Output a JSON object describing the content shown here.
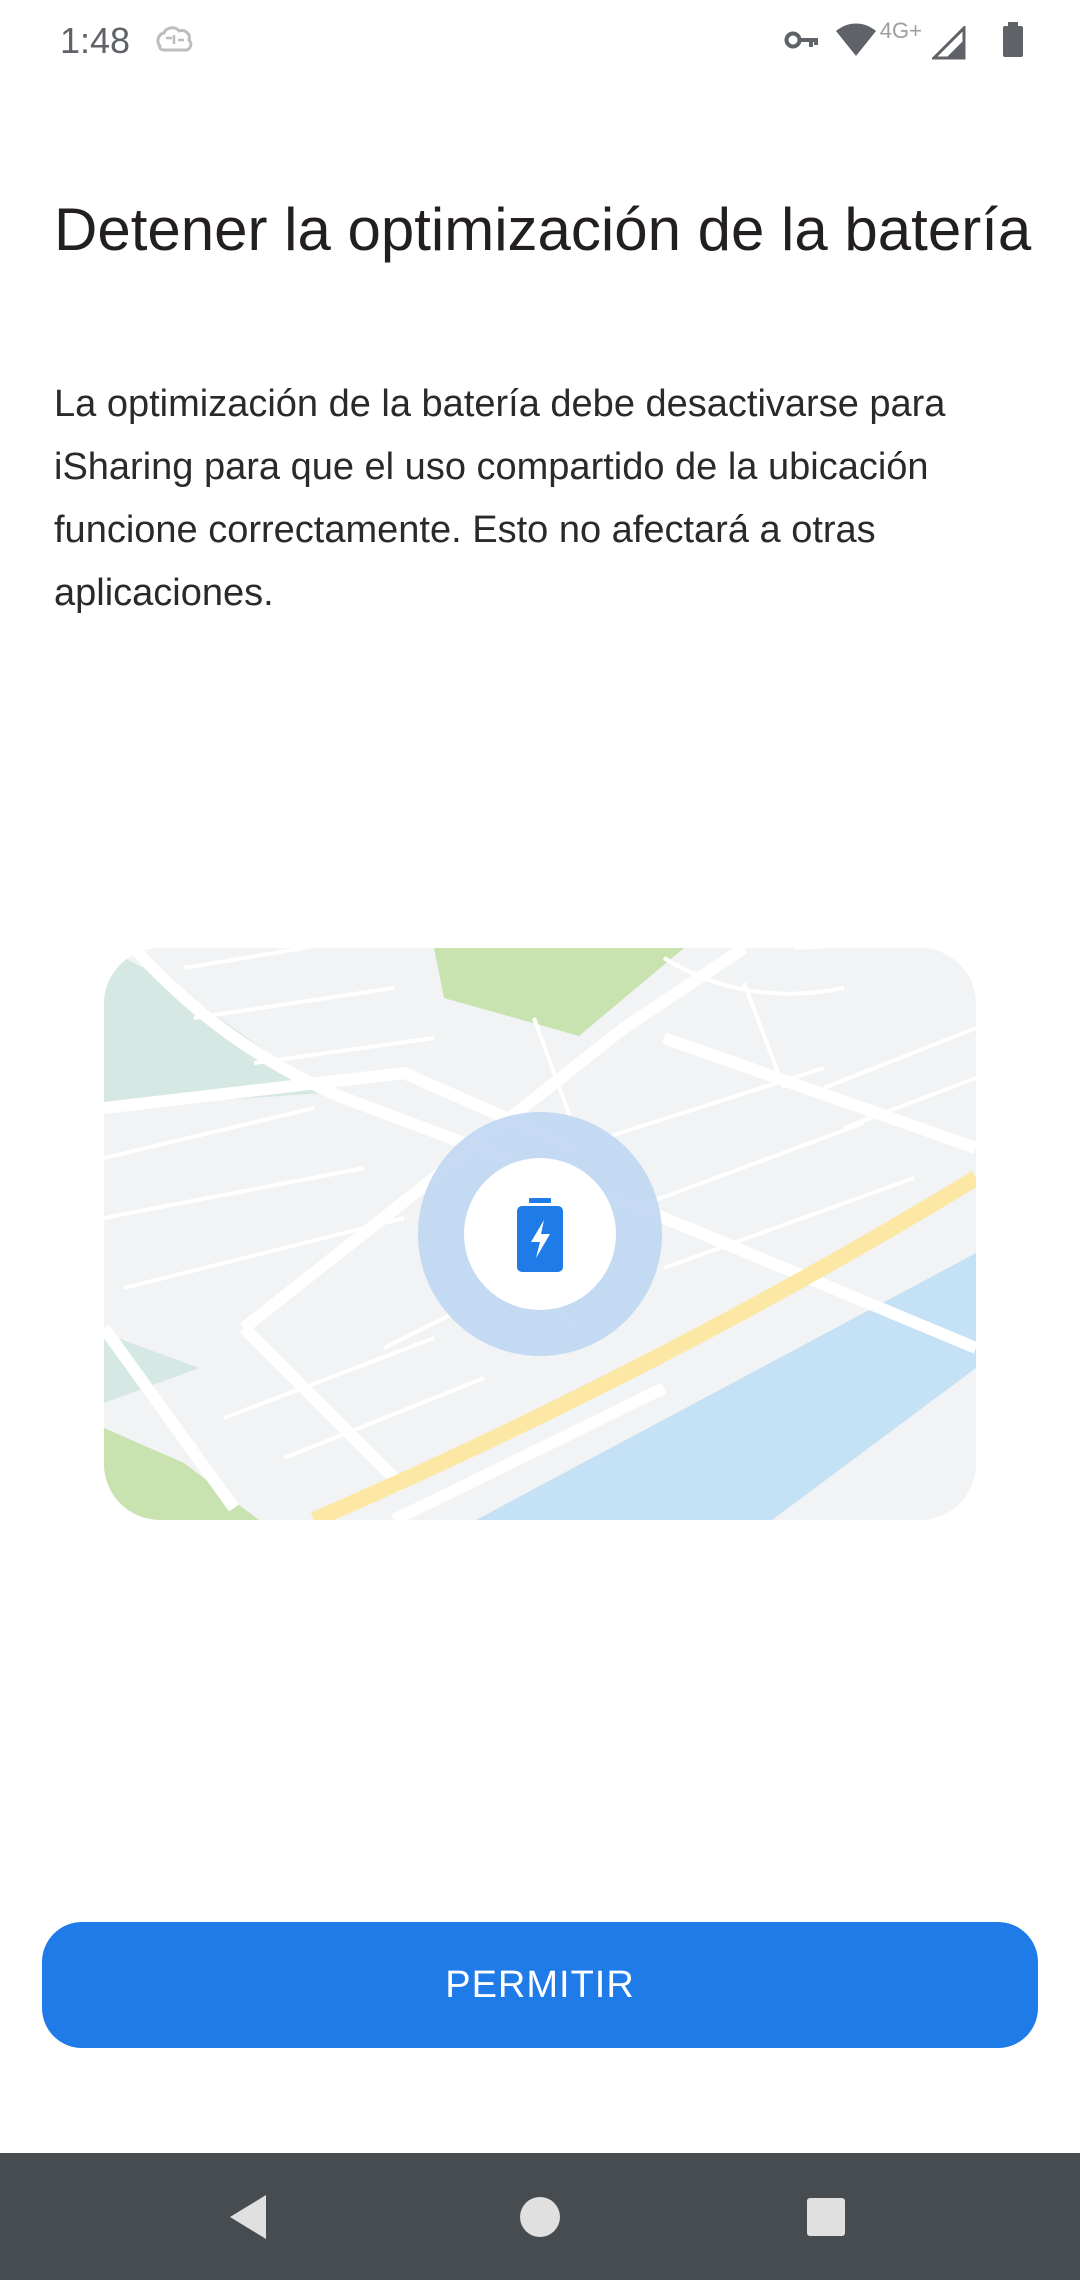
{
  "status_bar": {
    "time": "1:48",
    "network": "4G+",
    "icons": [
      "brain-icon",
      "vpn-key-icon",
      "wifi-icon",
      "signal-icon",
      "battery-icon"
    ]
  },
  "screen": {
    "title": "Detener la optimización de la batería",
    "description": "La optimización de la batería debe desactivarse para iSharing para que el uso compartido de la ubicación funcione correctamente. Esto no afectará a otras aplicaciones.",
    "illustration_icon": "battery-charging-icon"
  },
  "actions": {
    "allow_label": "PERMITIR"
  },
  "nav_bar": {
    "icons": [
      "back-icon",
      "home-icon",
      "recents-icon"
    ]
  },
  "colors": {
    "primary": "#1f7be8",
    "nav_bar": "#474c51",
    "map_water": "#c5e1f5",
    "map_park": "#c8e3b0",
    "map_highway": "#fce8a4"
  }
}
